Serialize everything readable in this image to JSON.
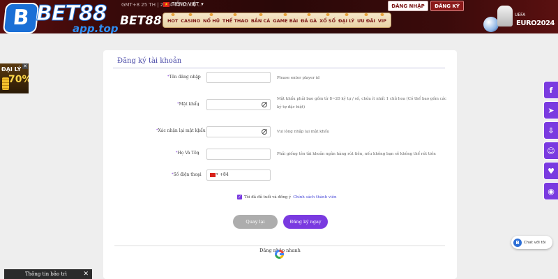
{
  "header": {
    "logo_letter": "B",
    "logo_text": "BET88",
    "logo_sub": "app.top",
    "logo_text2": "BET88",
    "time_info": "GMT+8 25 TH | 2024 01:15:09 ...",
    "language": "TIẾNG VIỆT",
    "login_label": "ĐĂNG NHẬP",
    "register_label": "ĐĂNG KÝ",
    "nav_items": [
      "HOT",
      "CASINO",
      "NỔ HŨ",
      "THỂ THAO",
      "BẮN CÁ",
      "GAME BÀI",
      "ĐÁ GÀ",
      "XỔ SỐ",
      "ĐẠI LÝ",
      "ƯU ĐÃI",
      "VIP"
    ],
    "euro_label": "EURO2024",
    "uefa_label": "UEFA"
  },
  "promo": {
    "title": "ĐẠI LÝ",
    "percent": "70%",
    "close": "✕"
  },
  "form": {
    "title": "Đăng ký tài khoản",
    "fields": [
      {
        "label": "Tên đăng nhập",
        "hint": "Please enter player id"
      },
      {
        "label": "Mật khẩu",
        "hint": "Mật khẩu phải bao gồm từ 8~20 ký tự / số, chứa ít nhất 1 chữ hoa (Có thể bao gồm các",
        "hint2": "ký tự đặc biệt)"
      },
      {
        "label": "Xác nhận lại mật khẩu",
        "hint": "Vui lòng nhập lại mật khẩu"
      },
      {
        "label": "Họ Và Tên",
        "hint": "Phải giống tên tài khoản ngân hàng rút tiền, nếu không bạn sẽ không thể rút tiền"
      },
      {
        "label": "Số điện thoại",
        "phone_code": "+84"
      }
    ],
    "colon": ":",
    "agree_text": "Tôi đã đủ tuổi và đồng ý",
    "policy_link": "Chính sách thành viên",
    "back_label": "Quay lại",
    "submit_label": "Đăng ký ngay",
    "quick_login": "Đăng nhập nhanh"
  },
  "social": [
    {
      "icon": "facebook-icon",
      "glyph": "f"
    },
    {
      "icon": "telegram-icon",
      "glyph": "➤"
    },
    {
      "icon": "download-icon",
      "glyph": "⇩"
    },
    {
      "icon": "agent-icon",
      "glyph": "☺"
    },
    {
      "icon": "gift-icon",
      "glyph": "♥"
    },
    {
      "icon": "support-icon",
      "glyph": "◉"
    }
  ],
  "chat": {
    "icon_letter": "B",
    "label": "Chat với tôi"
  },
  "maintenance": {
    "label": "Thông tin bảo trì",
    "close": "✕"
  }
}
